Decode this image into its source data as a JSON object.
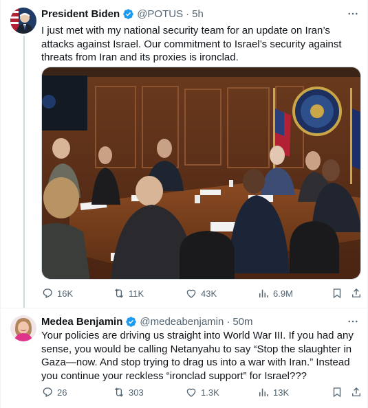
{
  "tweets": [
    {
      "author": "President Biden",
      "handle": "@POTUS",
      "separator": "·",
      "time": "5h",
      "text": "I just met with my national security team for an update on Iran’s attacks against Israel. Our commitment to Israel’s security against threats from Iran and its proxies is ironclad.",
      "stats": {
        "replies": "16K",
        "reposts": "11K",
        "likes": "43K",
        "views": "6.9M"
      },
      "has_media": true
    },
    {
      "author": "Medea Benjamin",
      "handle": "@medeabenjamin",
      "separator": "·",
      "time": "50m",
      "text": "Your policies are driving us straight into World War III. If you had any sense, you would be calling Netanyahu to say “Stop the slaughter in Gaza—now. And stop trying to drag us into a war with Iran.” Instead you continue your reckless “ironclad support” for Israel???",
      "stats": {
        "replies": "26",
        "reposts": "303",
        "likes": "1.3K",
        "views": "13K"
      },
      "has_media": false
    }
  ],
  "icons": {
    "verified": "verified-badge-icon",
    "more": "more-icon",
    "reply": "reply-icon",
    "repost": "repost-icon",
    "like": "heart-icon",
    "views": "views-icon",
    "bookmark": "bookmark-icon",
    "share": "share-icon"
  },
  "colors": {
    "verified_blue": "#1d9bf0",
    "muted": "#536471",
    "text": "#0f1419",
    "divider": "#eff3f4"
  }
}
